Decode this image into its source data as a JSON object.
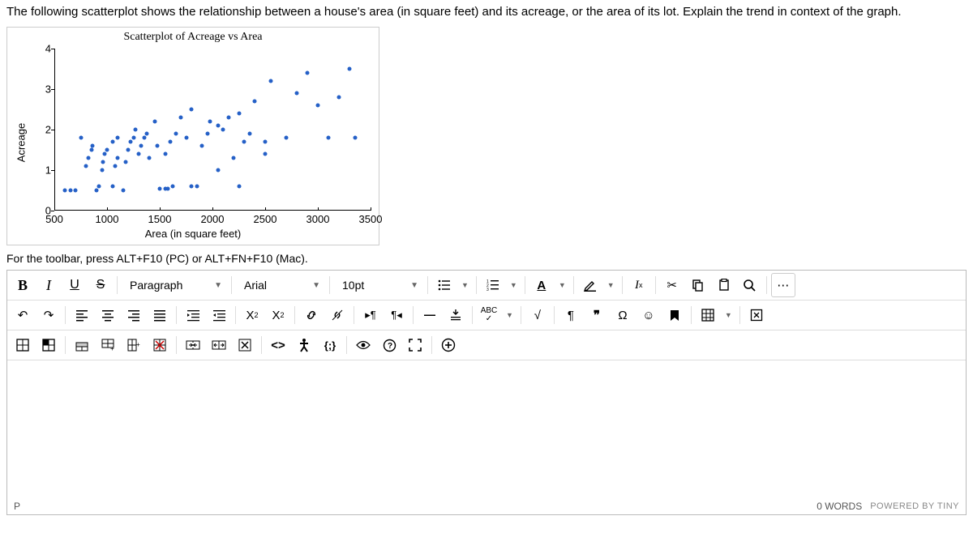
{
  "prompt": "The following scatterplot shows the relationship between a house's area (in square feet) and its acreage, or the area of its lot. Explain the trend in context of the graph.",
  "toolbar_hint": "For the toolbar, press ALT+F10 (PC) or ALT+FN+F10 (Mac).",
  "selects": {
    "block": "Paragraph",
    "font": "Arial",
    "size": "10pt"
  },
  "status": {
    "path": "P",
    "words": "0 WORDS",
    "powered": "POWERED BY TINY"
  },
  "chart_data": {
    "type": "scatter",
    "title": "Scatterplot of Acreage vs Area",
    "xlabel": "Area (in square feet)",
    "ylabel": "Acreage",
    "xlim": [
      500,
      3500
    ],
    "ylim": [
      0,
      4
    ],
    "x_ticks": [
      500,
      1000,
      1500,
      2000,
      2500,
      3000,
      3500
    ],
    "y_ticks": [
      0,
      1,
      2,
      3,
      4
    ],
    "points": [
      {
        "x": 600,
        "y": 0.5
      },
      {
        "x": 650,
        "y": 0.5
      },
      {
        "x": 700,
        "y": 0.5
      },
      {
        "x": 750,
        "y": 1.8
      },
      {
        "x": 800,
        "y": 1.1
      },
      {
        "x": 820,
        "y": 1.3
      },
      {
        "x": 850,
        "y": 1.5
      },
      {
        "x": 860,
        "y": 1.6
      },
      {
        "x": 900,
        "y": 0.5
      },
      {
        "x": 920,
        "y": 0.6
      },
      {
        "x": 950,
        "y": 1.0
      },
      {
        "x": 960,
        "y": 1.2
      },
      {
        "x": 980,
        "y": 1.4
      },
      {
        "x": 1000,
        "y": 1.5
      },
      {
        "x": 1050,
        "y": 0.6
      },
      {
        "x": 1050,
        "y": 1.7
      },
      {
        "x": 1080,
        "y": 1.1
      },
      {
        "x": 1100,
        "y": 1.3
      },
      {
        "x": 1100,
        "y": 1.8
      },
      {
        "x": 1150,
        "y": 0.5
      },
      {
        "x": 1180,
        "y": 1.2
      },
      {
        "x": 1200,
        "y": 1.5
      },
      {
        "x": 1220,
        "y": 1.7
      },
      {
        "x": 1250,
        "y": 1.8
      },
      {
        "x": 1270,
        "y": 2.0
      },
      {
        "x": 1300,
        "y": 1.4
      },
      {
        "x": 1320,
        "y": 1.6
      },
      {
        "x": 1350,
        "y": 1.8
      },
      {
        "x": 1380,
        "y": 1.9
      },
      {
        "x": 1400,
        "y": 1.3
      },
      {
        "x": 1450,
        "y": 2.2
      },
      {
        "x": 1480,
        "y": 1.6
      },
      {
        "x": 1500,
        "y": 0.55
      },
      {
        "x": 1550,
        "y": 0.55
      },
      {
        "x": 1580,
        "y": 0.55
      },
      {
        "x": 1620,
        "y": 0.6
      },
      {
        "x": 1550,
        "y": 1.4
      },
      {
        "x": 1600,
        "y": 1.7
      },
      {
        "x": 1650,
        "y": 1.9
      },
      {
        "x": 1700,
        "y": 2.3
      },
      {
        "x": 1750,
        "y": 1.8
      },
      {
        "x": 1800,
        "y": 0.6
      },
      {
        "x": 1850,
        "y": 0.6
      },
      {
        "x": 1800,
        "y": 2.5
      },
      {
        "x": 1900,
        "y": 1.6
      },
      {
        "x": 1950,
        "y": 1.9
      },
      {
        "x": 1980,
        "y": 2.2
      },
      {
        "x": 2050,
        "y": 1.0
      },
      {
        "x": 2050,
        "y": 2.1
      },
      {
        "x": 2100,
        "y": 2.0
      },
      {
        "x": 2150,
        "y": 2.3
      },
      {
        "x": 2200,
        "y": 1.3
      },
      {
        "x": 2250,
        "y": 0.6
      },
      {
        "x": 2250,
        "y": 2.4
      },
      {
        "x": 2300,
        "y": 1.7
      },
      {
        "x": 2350,
        "y": 1.9
      },
      {
        "x": 2400,
        "y": 2.7
      },
      {
        "x": 2500,
        "y": 1.4
      },
      {
        "x": 2500,
        "y": 1.7
      },
      {
        "x": 2550,
        "y": 3.2
      },
      {
        "x": 2700,
        "y": 1.8
      },
      {
        "x": 2800,
        "y": 2.9
      },
      {
        "x": 2900,
        "y": 3.4
      },
      {
        "x": 3000,
        "y": 2.6
      },
      {
        "x": 3100,
        "y": 1.8
      },
      {
        "x": 3200,
        "y": 2.8
      },
      {
        "x": 3300,
        "y": 3.5
      },
      {
        "x": 3350,
        "y": 1.8
      }
    ]
  }
}
